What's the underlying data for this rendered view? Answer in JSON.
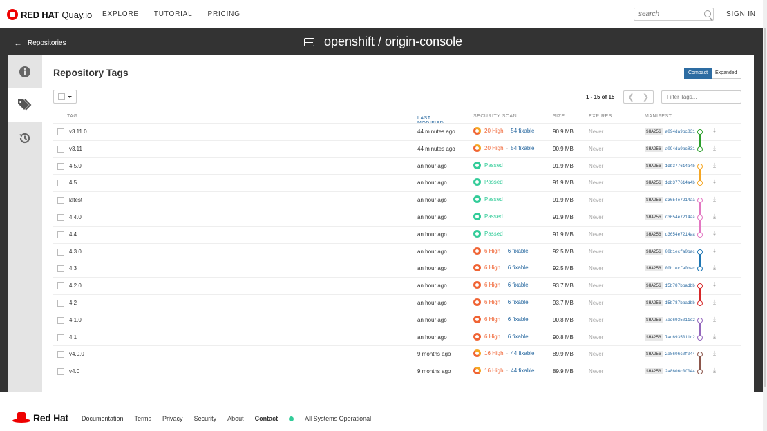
{
  "nav": {
    "brand": "RED HAT",
    "product": "Quay.io",
    "links": [
      "EXPLORE",
      "TUTORIAL",
      "PRICING"
    ],
    "search_placeholder": "search",
    "signin": "SIGN IN"
  },
  "header": {
    "back_label": "Repositories",
    "repo_title": "openshift / origin-console"
  },
  "page": {
    "title": "Repository Tags",
    "view_compact": "Compact",
    "view_expanded": "Expanded",
    "pager": "1 - 15 of 15",
    "filter_placeholder": "Filter Tags..."
  },
  "columns": {
    "tag": "TAG",
    "last_modified": "LAST MODIFIED",
    "security_scan": "SECURITY SCAN",
    "size": "SIZE",
    "expires": "EXPIRES",
    "manifest": "MANIFEST"
  },
  "colors": {
    "accent": "#2d6ca2",
    "high": "#f06434",
    "passed": "#33cc99",
    "green": "#2ca02c",
    "orange": "#f5a623",
    "pink": "#e377c2",
    "blue": "#1f77b4",
    "red": "#d62728",
    "purple": "#9467bd",
    "brown": "#8c564b"
  },
  "rows": [
    {
      "tag": "v3.11.0",
      "modified": "44 minutes ago",
      "scan": "warn",
      "high": "20 High",
      "fixable": "54 fixable",
      "size": "90.9 MB",
      "expires": "Never",
      "sha": "SHA256",
      "digest": "a094da9bc831",
      "color": "green"
    },
    {
      "tag": "v3.11",
      "modified": "44 minutes ago",
      "scan": "warn",
      "high": "20 High",
      "fixable": "54 fixable",
      "size": "90.9 MB",
      "expires": "Never",
      "sha": "SHA256",
      "digest": "a094da9bc831",
      "color": "green"
    },
    {
      "tag": "4.5.0",
      "modified": "an hour ago",
      "scan": "pass",
      "passed": "Passed",
      "size": "91.9 MB",
      "expires": "Never",
      "sha": "SHA256",
      "digest": "1db377614a4b",
      "color": "orange"
    },
    {
      "tag": "4.5",
      "modified": "an hour ago",
      "scan": "pass",
      "passed": "Passed",
      "size": "91.9 MB",
      "expires": "Never",
      "sha": "SHA256",
      "digest": "1db377614a4b",
      "color": "orange"
    },
    {
      "tag": "latest",
      "modified": "an hour ago",
      "scan": "pass",
      "passed": "Passed",
      "size": "91.9 MB",
      "expires": "Never",
      "sha": "SHA256",
      "digest": "d3654e7214aa",
      "color": "pink"
    },
    {
      "tag": "4.4.0",
      "modified": "an hour ago",
      "scan": "pass",
      "passed": "Passed",
      "size": "91.9 MB",
      "expires": "Never",
      "sha": "SHA256",
      "digest": "d3654e7214aa",
      "color": "pink"
    },
    {
      "tag": "4.4",
      "modified": "an hour ago",
      "scan": "pass",
      "passed": "Passed",
      "size": "91.9 MB",
      "expires": "Never",
      "sha": "SHA256",
      "digest": "d3654e7214aa",
      "color": "pink"
    },
    {
      "tag": "4.3.0",
      "modified": "an hour ago",
      "scan": "vuln",
      "high": "6 High",
      "fixable": "6 fixable",
      "size": "92.5 MB",
      "expires": "Never",
      "sha": "SHA256",
      "digest": "00b1ecfa0bac",
      "color": "blue"
    },
    {
      "tag": "4.3",
      "modified": "an hour ago",
      "scan": "vuln",
      "high": "6 High",
      "fixable": "6 fixable",
      "size": "92.5 MB",
      "expires": "Never",
      "sha": "SHA256",
      "digest": "00b1ecfa0bac",
      "color": "blue"
    },
    {
      "tag": "4.2.0",
      "modified": "an hour ago",
      "scan": "vuln",
      "high": "6 High",
      "fixable": "6 fixable",
      "size": "93.7 MB",
      "expires": "Never",
      "sha": "SHA256",
      "digest": "15b787bbadbb",
      "color": "red"
    },
    {
      "tag": "4.2",
      "modified": "an hour ago",
      "scan": "vuln",
      "high": "6 High",
      "fixable": "6 fixable",
      "size": "93.7 MB",
      "expires": "Never",
      "sha": "SHA256",
      "digest": "15b787bbadbb",
      "color": "red"
    },
    {
      "tag": "4.1.0",
      "modified": "an hour ago",
      "scan": "vuln",
      "high": "6 High",
      "fixable": "6 fixable",
      "size": "90.8 MB",
      "expires": "Never",
      "sha": "SHA256",
      "digest": "7ad6935011c2",
      "color": "purple"
    },
    {
      "tag": "4.1",
      "modified": "an hour ago",
      "scan": "vuln",
      "high": "6 High",
      "fixable": "6 fixable",
      "size": "90.8 MB",
      "expires": "Never",
      "sha": "SHA256",
      "digest": "7ad6935011c2",
      "color": "purple"
    },
    {
      "tag": "v4.0.0",
      "modified": "9 months ago",
      "scan": "warn",
      "high": "16 High",
      "fixable": "44 fixable",
      "size": "89.9 MB",
      "expires": "Never",
      "sha": "SHA256",
      "digest": "2a8606c0f044",
      "color": "brown"
    },
    {
      "tag": "v4.0",
      "modified": "9 months ago",
      "scan": "warn",
      "high": "16 High",
      "fixable": "44 fixable",
      "size": "89.9 MB",
      "expires": "Never",
      "sha": "SHA256",
      "digest": "2a8606c0f044",
      "color": "brown"
    }
  ],
  "footer": {
    "brand": "Red Hat",
    "links": [
      "Documentation",
      "Terms",
      "Privacy",
      "Security",
      "About",
      "Contact"
    ],
    "status": "All Systems Operational"
  }
}
